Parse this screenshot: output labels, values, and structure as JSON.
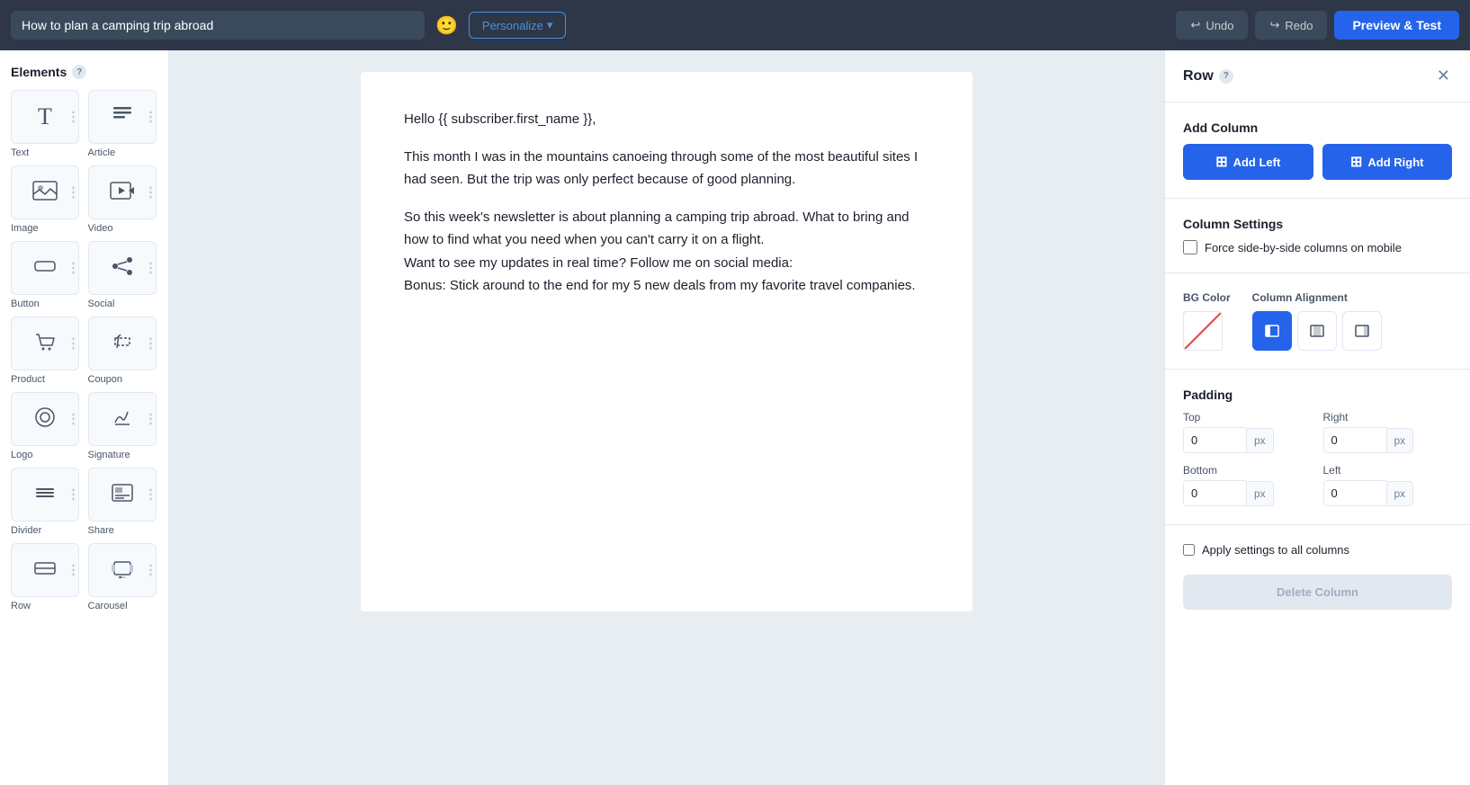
{
  "topbar": {
    "subject": "How to plan a camping trip abroad",
    "personalize_label": "Personalize",
    "undo_label": "Undo",
    "redo_label": "Redo",
    "preview_label": "Preview & Test"
  },
  "sidebar": {
    "title": "Elements",
    "elements": [
      {
        "id": "text",
        "label": "Text",
        "icon": "T"
      },
      {
        "id": "article",
        "label": "Article",
        "icon": "≡"
      },
      {
        "id": "image",
        "label": "Image",
        "icon": "🖼"
      },
      {
        "id": "video",
        "label": "Video",
        "icon": "▶"
      },
      {
        "id": "button",
        "label": "Button",
        "icon": "⬜"
      },
      {
        "id": "social",
        "label": "Social",
        "icon": "⋈"
      },
      {
        "id": "product",
        "label": "Product",
        "icon": "🛒"
      },
      {
        "id": "coupon",
        "label": "Coupon",
        "icon": "✂"
      },
      {
        "id": "logo",
        "label": "Logo",
        "icon": "◎"
      },
      {
        "id": "signature",
        "label": "Signature",
        "icon": "✏"
      },
      {
        "id": "divider",
        "label": "Divider",
        "icon": "—"
      },
      {
        "id": "share",
        "label": "Share",
        "icon": "📰"
      },
      {
        "id": "row",
        "label": "Row",
        "icon": "☰"
      },
      {
        "id": "carousel",
        "label": "Carousel",
        "icon": "🖼"
      }
    ]
  },
  "canvas": {
    "email_content": [
      "Hello {{ subscriber.first_name }},",
      "This month I was in the mountains canoeing through some of the most beautiful sites I had seen. But the trip was only perfect because of good planning.",
      "So this week's newsletter is about planning a camping trip abroad. What to bring and how to find what you need when you can't carry it on a flight.\nWant to see my updates in real time? Follow me on social media:\nBonus: Stick around to the end for my 5 new deals from my favorite travel companies."
    ]
  },
  "right_panel": {
    "title": "Row",
    "add_column": {
      "section_label": "Add Column",
      "add_left_label": "Add Left",
      "add_right_label": "Add Right"
    },
    "column_settings": {
      "section_label": "Column Settings",
      "force_mobile_label": "Force side-by-side columns on mobile",
      "force_mobile_checked": false
    },
    "bg_color": {
      "label": "BG Color"
    },
    "column_alignment": {
      "label": "Column Alignment",
      "options": [
        "left",
        "center",
        "right"
      ],
      "active": "left"
    },
    "padding": {
      "label": "Padding",
      "top_label": "Top",
      "right_label": "Right",
      "bottom_label": "Bottom",
      "left_label": "Left",
      "top_value": "0",
      "right_value": "0",
      "bottom_value": "0",
      "left_value": "0",
      "unit": "px"
    },
    "apply_settings": {
      "label": "Apply settings to all columns",
      "checked": false
    },
    "delete_column": {
      "label": "Delete Column"
    }
  }
}
